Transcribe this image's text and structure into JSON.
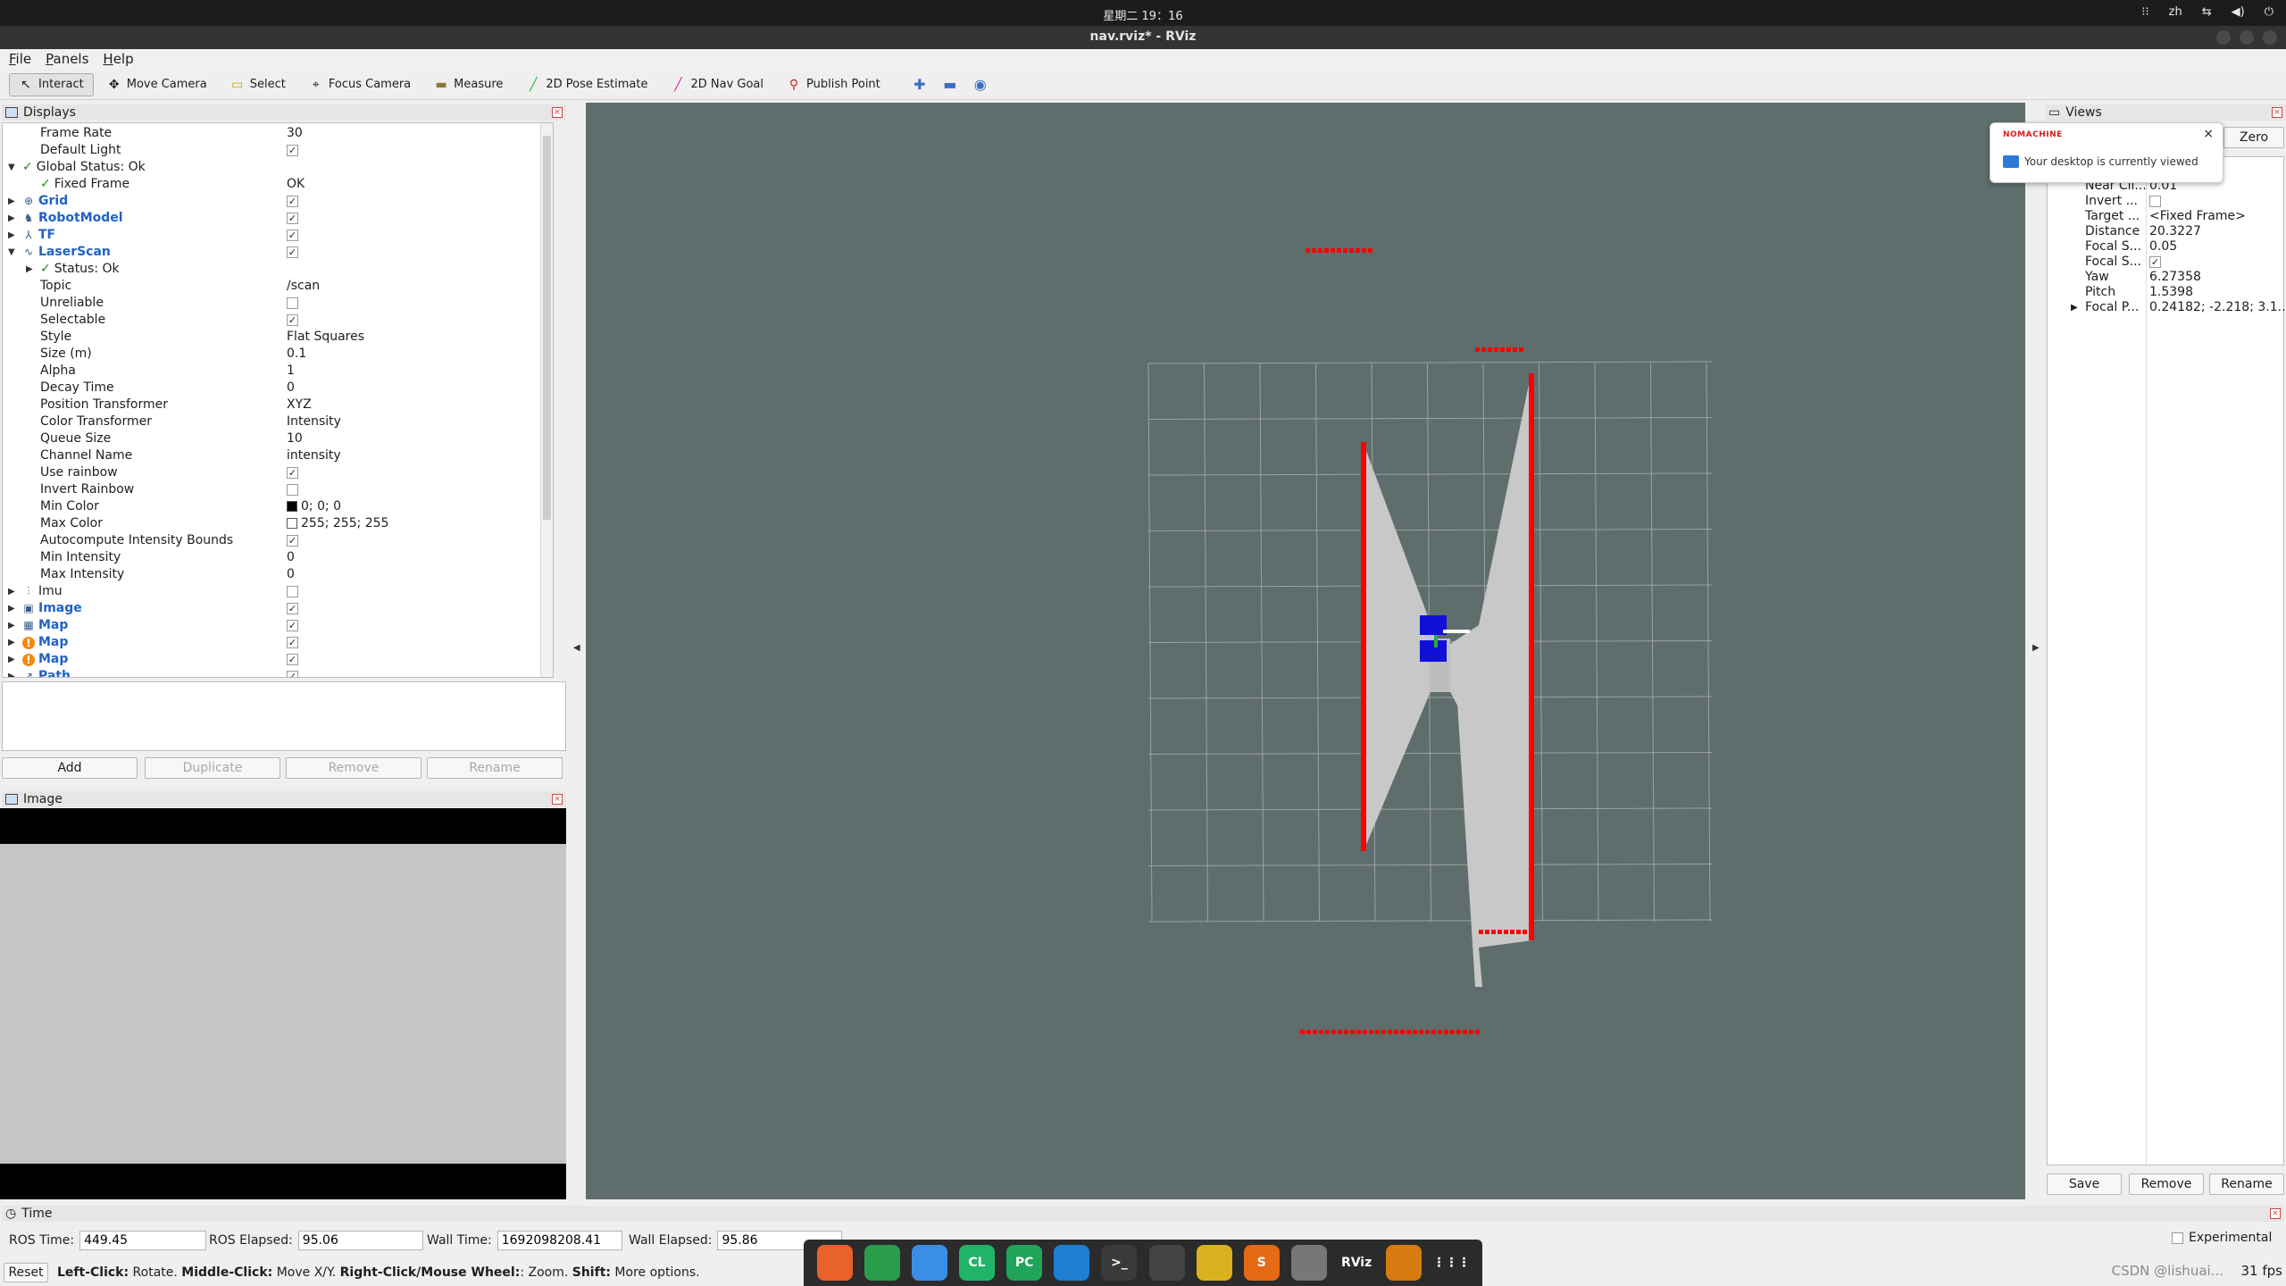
{
  "topbar": {
    "apple": "",
    "clock": "星期二 19：16",
    "lang": "zh",
    "tray_icons": [
      "network-icon",
      "volume-icon",
      "power-icon"
    ]
  },
  "window": {
    "title": "nav.rviz* - RViz"
  },
  "menu": [
    "File",
    "Panels",
    "Help"
  ],
  "toolbar": {
    "tools": [
      {
        "name": "interact",
        "label": "Interact",
        "icon": "cursor-icon",
        "active": true
      },
      {
        "name": "move-camera",
        "label": "Move Camera",
        "icon": "move-icon"
      },
      {
        "name": "select",
        "label": "Select",
        "icon": "select-icon"
      },
      {
        "name": "focus-camera",
        "label": "Focus Camera",
        "icon": "focus-icon"
      },
      {
        "name": "measure",
        "label": "Measure",
        "icon": "ruler-icon"
      },
      {
        "name": "2d-pose-estimate",
        "label": "2D Pose Estimate",
        "icon": "green-arrow-icon"
      },
      {
        "name": "2d-nav-goal",
        "label": "2D Nav Goal",
        "icon": "pink-arrow-icon"
      },
      {
        "name": "publish-point",
        "label": "Publish Point",
        "icon": "pin-icon"
      }
    ]
  },
  "displays": {
    "title": "Displays",
    "rows": [
      {
        "indent": 1,
        "label": "Frame Rate",
        "value": "30"
      },
      {
        "indent": 1,
        "label": "Default Light",
        "check": true
      },
      {
        "indent": 0,
        "arrow": "▼",
        "ok": "✓",
        "label": "Global Status: Ok"
      },
      {
        "indent": 1,
        "ok": "✓",
        "label": "Fixed Frame",
        "value": "OK"
      },
      {
        "indent": 0,
        "arrow": "▶",
        "icon": "grid-icon",
        "glyph": "⊕",
        "label": "Grid",
        "blue": true,
        "check": true
      },
      {
        "indent": 0,
        "arrow": "▶",
        "icon": "robot-icon",
        "glyph": "♞",
        "label": "RobotModel",
        "blue": true,
        "check": true
      },
      {
        "indent": 0,
        "arrow": "▶",
        "icon": "tf-icon",
        "glyph": "⅄",
        "label": "TF",
        "blue": true,
        "check": true
      },
      {
        "indent": 0,
        "arrow": "▼",
        "icon": "laserscan-icon",
        "glyph": "∿",
        "label": "LaserScan",
        "blue": true,
        "check": true
      },
      {
        "indent": 1,
        "arrow": "▶",
        "ok": "✓",
        "label": "Status: Ok"
      },
      {
        "indent": 1,
        "label": "Topic",
        "value": "/scan"
      },
      {
        "indent": 1,
        "label": "Unreliable",
        "check": false
      },
      {
        "indent": 1,
        "label": "Selectable",
        "check": true
      },
      {
        "indent": 1,
        "label": "Style",
        "value": "Flat Squares"
      },
      {
        "indent": 1,
        "label": "Size (m)",
        "value": "0.1"
      },
      {
        "indent": 1,
        "label": "Alpha",
        "value": "1"
      },
      {
        "indent": 1,
        "label": "Decay Time",
        "value": "0"
      },
      {
        "indent": 1,
        "label": "Position Transformer",
        "value": "XYZ"
      },
      {
        "indent": 1,
        "label": "Color Transformer",
        "value": "Intensity"
      },
      {
        "indent": 1,
        "label": "Queue Size",
        "value": "10"
      },
      {
        "indent": 1,
        "label": "Channel Name",
        "value": "intensity"
      },
      {
        "indent": 1,
        "label": "Use rainbow",
        "check": true
      },
      {
        "indent": 1,
        "label": "Invert Rainbow",
        "check": false
      },
      {
        "indent": 1,
        "label": "Min Color",
        "swatch": "#000000",
        "value": "0; 0; 0"
      },
      {
        "indent": 1,
        "label": "Max Color",
        "swatch": "#ffffff",
        "value": "255; 255; 255"
      },
      {
        "indent": 1,
        "label": "Autocompute Intensity Bounds",
        "check": true
      },
      {
        "indent": 1,
        "label": "Min Intensity",
        "value": "0"
      },
      {
        "indent": 1,
        "label": "Max Intensity",
        "value": "0"
      },
      {
        "indent": 0,
        "arrow": "▶",
        "icon": "imu-icon",
        "glyph": "⫶",
        "label": "Imu",
        "check": false
      },
      {
        "indent": 0,
        "arrow": "▶",
        "icon": "image-icon",
        "glyph": "▣",
        "label": "Image",
        "blue": true,
        "check": true
      },
      {
        "indent": 0,
        "arrow": "▶",
        "icon": "map-icon",
        "glyph": "▦",
        "label": "Map",
        "blue": true,
        "check": true
      },
      {
        "indent": 0,
        "arrow": "▶",
        "icon": "warning-icon",
        "glyph": "!",
        "warn": true,
        "label": "Map",
        "blue": true,
        "check": true
      },
      {
        "indent": 0,
        "arrow": "▶",
        "icon": "warning-icon",
        "glyph": "!",
        "warn": true,
        "label": "Map",
        "blue": true,
        "check": true
      },
      {
        "indent": 0,
        "arrow": "▶",
        "icon": "path-icon",
        "glyph": "↗",
        "label": "Path",
        "blue": true,
        "check": true
      }
    ],
    "buttons": {
      "add": "Add",
      "duplicate": "Duplicate",
      "remove": "Remove",
      "rename": "Rename"
    }
  },
  "image_panel": {
    "title": "Image"
  },
  "views": {
    "title": "Views",
    "zero": "Zero",
    "rows": [
      {
        "label": "Near Cli...",
        "value": "0.01"
      },
      {
        "label": "Invert ...",
        "check": false
      },
      {
        "label": "Target ...",
        "value": "<Fixed Frame>"
      },
      {
        "label": "Distance",
        "value": "20.3227"
      },
      {
        "label": "Focal S...",
        "value": "0.05"
      },
      {
        "label": "Focal S...",
        "check": true
      },
      {
        "label": "Yaw",
        "value": "6.27358"
      },
      {
        "label": "Pitch",
        "value": "1.5398"
      },
      {
        "label": "Focal P...",
        "value": "0.24182; -2.218; 3.1...",
        "arrow": "▶"
      }
    ],
    "buttons": {
      "save": "Save",
      "remove": "Remove",
      "rename": "Rename"
    }
  },
  "nomachine": {
    "brand": "NOMACHINE",
    "message": "Your desktop is currently viewed",
    "close": "×"
  },
  "time": {
    "title": "Time",
    "ros_time_label": "ROS Time:",
    "ros_time": "449.45",
    "ros_elapsed_label": "ROS Elapsed:",
    "ros_elapsed": "95.06",
    "wall_time_label": "Wall Time:",
    "wall_time": "1692098208.41",
    "wall_elapsed_label": "Wall Elapsed:",
    "wall_elapsed": "95.86",
    "experimental": "Experimental"
  },
  "status": {
    "reset": "Reset",
    "left_click": "Left-Click:",
    "left_desc": " Rotate. ",
    "middle_click": "Middle-Click:",
    "middle_desc": " Move X/Y. ",
    "right_click": "Right-Click/Mouse Wheel:",
    "right_desc": ": Zoom. ",
    "shift": "Shift:",
    "shift_desc": " More options.",
    "fps": "31 fps"
  },
  "dock": [
    {
      "name": "firefox-icon",
      "label": "",
      "color": "#e8622a"
    },
    {
      "name": "chrome-icon",
      "label": "",
      "color": "#2a9d4b"
    },
    {
      "name": "finder-icon",
      "label": "",
      "color": "#3a8ee6"
    },
    {
      "name": "clion-icon",
      "label": "CL",
      "color": "#21b468"
    },
    {
      "name": "pycharm-icon",
      "label": "PC",
      "color": "#1fa45a"
    },
    {
      "name": "vscode-icon",
      "label": "",
      "color": "#1d7fd3"
    },
    {
      "name": "terminal-icon",
      "label": ">_",
      "color": "#3a3a3a"
    },
    {
      "name": "ros-icon",
      "label": "",
      "color": "#444444"
    },
    {
      "name": "app-icon",
      "label": "",
      "color": "#d9b21f"
    },
    {
      "name": "sublime-icon",
      "label": "S",
      "color": "#e56a16"
    },
    {
      "name": "nomachine-icon",
      "label": "",
      "color": "#777777"
    },
    {
      "name": "rviz-icon",
      "label": "RViz",
      "color": "#2b2b2b"
    },
    {
      "name": "stack-icon",
      "label": "",
      "color": "#d67b10"
    },
    {
      "name": "apps-grid-icon",
      "label": "⋮⋮⋮",
      "color": "#2b2b2b"
    }
  ],
  "watermark": "CSDN @lishuai...",
  "colors": {
    "view_bg": "#5f6e6c",
    "grid": "#9aa3a1",
    "scan_fill": "#c8c8c8",
    "scan_hit": "#ff0000",
    "robot": "#1010d8",
    "accent_blue": "#1f63c6"
  }
}
